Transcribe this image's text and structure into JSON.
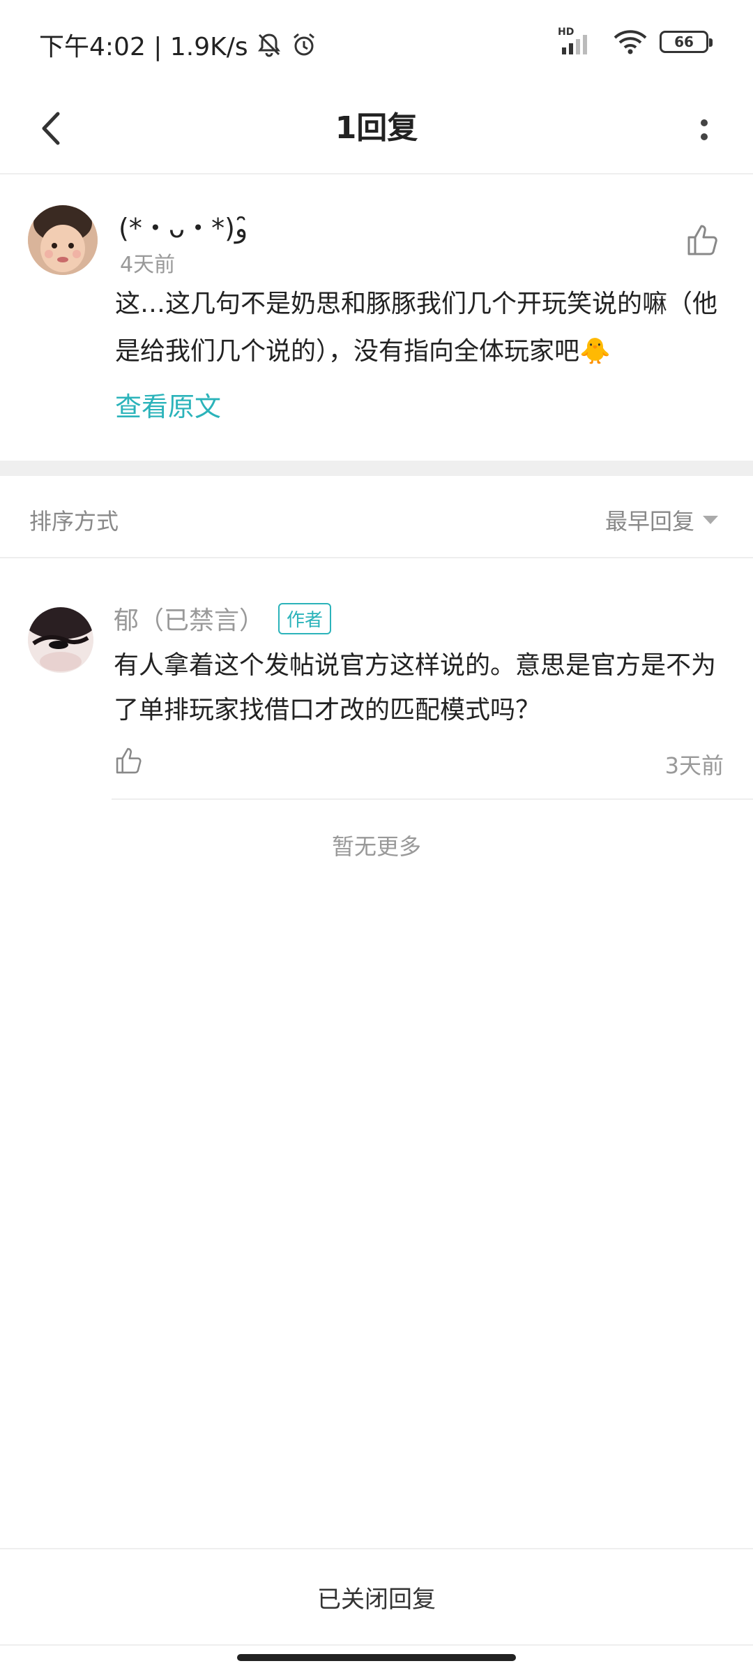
{
  "status_bar": {
    "time_speed": "下午4:02 | 1.9K/s",
    "network_label": "HD",
    "battery": "66"
  },
  "header": {
    "title": "1回复"
  },
  "main_comment": {
    "author": "(*・ᴗ・*)و ̑̑",
    "time": "4天前",
    "text": "这…这几句不是奶思和豚豚我们几个开玩笑说的嘛（他是给我们几个说的），没有指向全体玩家吧🐥",
    "view_original": "查看原文"
  },
  "sort": {
    "label": "排序方式",
    "value": "最早回复"
  },
  "replies": [
    {
      "author": "郁（已禁言）",
      "tag": "作者",
      "text": "有人拿着这个发帖说官方这样说的。意思是官方是不为了单排玩家找借口才改的匹配模式吗？",
      "time": "3天前"
    }
  ],
  "no_more": "暂无更多",
  "bottom": {
    "closed_label": "已关闭回复"
  },
  "colors": {
    "accent": "#2bb3ba",
    "muted": "#999999"
  }
}
